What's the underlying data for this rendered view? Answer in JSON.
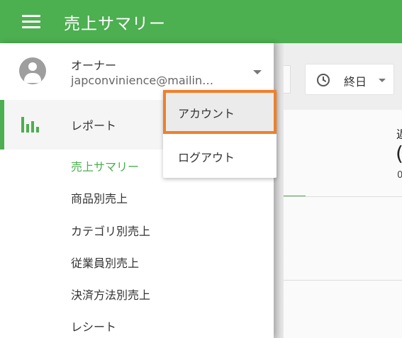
{
  "app_bar": {
    "title": "売上サマリー"
  },
  "main": {
    "date_range_label": "終日",
    "edge_text_top": "返",
    "edge_text_value": "(",
    "edge_text_small": "0"
  },
  "drawer": {
    "user": {
      "role": "オーナー",
      "email": "japconvinience@mailin…"
    },
    "report": {
      "label": "レポート"
    },
    "sub_items": [
      {
        "label": "売上サマリー",
        "active": true
      },
      {
        "label": "商品別売上",
        "active": false
      },
      {
        "label": "カテゴリ別売上",
        "active": false
      },
      {
        "label": "従業員別売上",
        "active": false
      },
      {
        "label": "決済方法別売上",
        "active": false
      },
      {
        "label": "レシート",
        "active": false
      }
    ]
  },
  "popup_menu": {
    "items": [
      {
        "label": "アカウント",
        "highlighted": true
      },
      {
        "label": "ログアウト",
        "highlighted": false
      }
    ]
  },
  "colors": {
    "brand_green": "#4caf50",
    "highlight_orange": "#f07f2a"
  }
}
